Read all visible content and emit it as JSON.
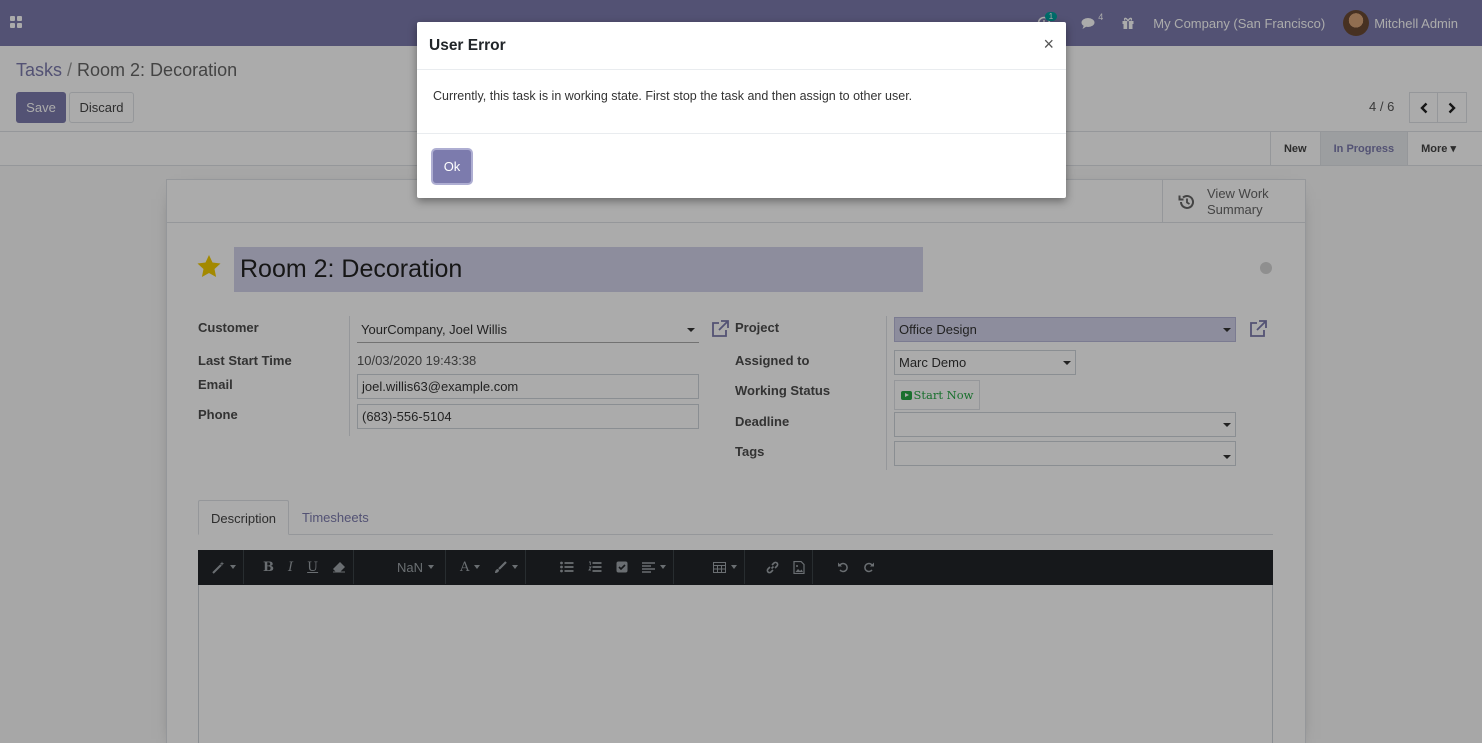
{
  "navbar": {
    "apps_icon": "apps-grid-icon",
    "timer_badge": "1",
    "messages_count": "4",
    "company": "My Company (San Francisco)",
    "user": "Mitchell Admin",
    "color": "#7c7bad"
  },
  "breadcrumb": {
    "parent": "Tasks",
    "separator": "/",
    "current": "Room 2: Decoration"
  },
  "actions": {
    "save": "Save",
    "discard": "Discard"
  },
  "pager": {
    "value": "4 / 6"
  },
  "stages": [
    {
      "label": "New"
    },
    {
      "label": "In Progress"
    },
    {
      "label": "More ▾"
    }
  ],
  "smart_button": {
    "label": "View Work Summary"
  },
  "task": {
    "title": "Room 2: Decoration",
    "starred": true
  },
  "left_fields": {
    "customer_label": "Customer",
    "customer_value": "YourCompany, Joel Willis",
    "last_start_label": "Last Start Time",
    "last_start_value": "10/03/2020 19:43:38",
    "email_label": "Email",
    "email_value": "joel.willis63@example.com",
    "phone_label": "Phone",
    "phone_value": "(683)-556-5104"
  },
  "right_fields": {
    "project_label": "Project",
    "project_value": "Office Design",
    "assigned_label": "Assigned to",
    "assigned_value": "Marc Demo",
    "working_status_label": "Working Status",
    "start_now": "Start Now",
    "deadline_label": "Deadline",
    "deadline_value": "",
    "tags_label": "Tags",
    "tags_value": ""
  },
  "tabs": [
    {
      "label": "Description",
      "active": true
    },
    {
      "label": "Timesheets",
      "active": false
    }
  ],
  "editor_toolbar": {
    "font_size": "NaN",
    "bold": "B",
    "italic": "I",
    "underline": "U",
    "font_color": "A"
  },
  "dialog": {
    "title": "User Error",
    "close": "×",
    "message": "Currently, this task is in working state. First stop the task and then assign to other user.",
    "ok": "Ok"
  }
}
